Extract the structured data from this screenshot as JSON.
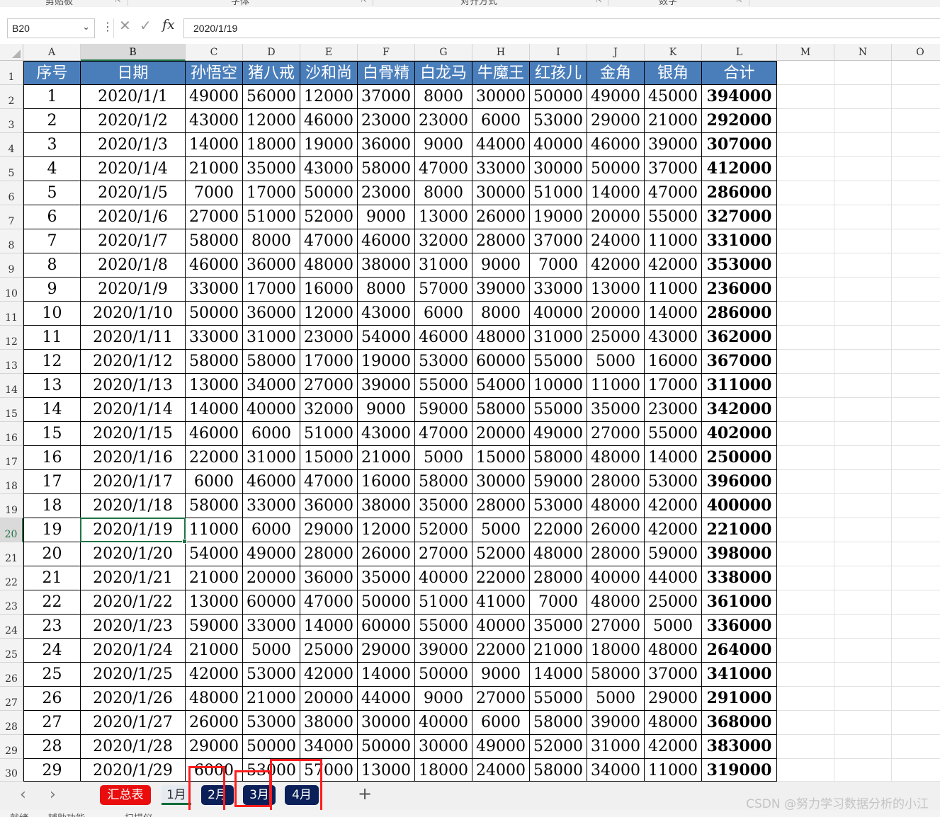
{
  "ribbon": {
    "groups": [
      "剪贴板",
      "字体",
      "对齐方式",
      "数字"
    ]
  },
  "formula_bar": {
    "name_box": "B20",
    "fx": "fx",
    "value": "2020/1/19"
  },
  "sheet": {
    "columns": [
      "A",
      "B",
      "C",
      "D",
      "E",
      "F",
      "G",
      "H",
      "I",
      "J",
      "K",
      "L",
      "M",
      "N",
      "O"
    ],
    "selected_column": "B",
    "selected_row": 20,
    "header_row": [
      "序号",
      "日期",
      "孙悟空",
      "猪八戒",
      "沙和尚",
      "白骨精",
      "白龙马",
      "牛魔王",
      "红孩儿",
      "金角",
      "银角",
      "合计"
    ],
    "rows": [
      [
        "1",
        "2020/1/1",
        "49000",
        "56000",
        "12000",
        "37000",
        "8000",
        "30000",
        "50000",
        "49000",
        "45000",
        "394000"
      ],
      [
        "2",
        "2020/1/2",
        "43000",
        "12000",
        "46000",
        "23000",
        "23000",
        "6000",
        "53000",
        "29000",
        "21000",
        "292000"
      ],
      [
        "3",
        "2020/1/3",
        "14000",
        "18000",
        "19000",
        "36000",
        "9000",
        "44000",
        "40000",
        "46000",
        "39000",
        "307000"
      ],
      [
        "4",
        "2020/1/4",
        "21000",
        "35000",
        "43000",
        "58000",
        "47000",
        "33000",
        "30000",
        "50000",
        "37000",
        "412000"
      ],
      [
        "5",
        "2020/1/5",
        "7000",
        "17000",
        "50000",
        "23000",
        "8000",
        "30000",
        "51000",
        "14000",
        "47000",
        "286000"
      ],
      [
        "6",
        "2020/1/6",
        "27000",
        "51000",
        "52000",
        "9000",
        "13000",
        "26000",
        "19000",
        "20000",
        "55000",
        "327000"
      ],
      [
        "7",
        "2020/1/7",
        "58000",
        "8000",
        "47000",
        "46000",
        "32000",
        "28000",
        "37000",
        "24000",
        "11000",
        "331000"
      ],
      [
        "8",
        "2020/1/8",
        "46000",
        "36000",
        "48000",
        "38000",
        "31000",
        "9000",
        "7000",
        "42000",
        "42000",
        "353000"
      ],
      [
        "9",
        "2020/1/9",
        "33000",
        "17000",
        "16000",
        "8000",
        "57000",
        "39000",
        "33000",
        "13000",
        "11000",
        "236000"
      ],
      [
        "10",
        "2020/1/10",
        "50000",
        "36000",
        "12000",
        "43000",
        "6000",
        "8000",
        "40000",
        "20000",
        "14000",
        "286000"
      ],
      [
        "11",
        "2020/1/11",
        "33000",
        "31000",
        "23000",
        "54000",
        "46000",
        "48000",
        "31000",
        "25000",
        "43000",
        "362000"
      ],
      [
        "12",
        "2020/1/12",
        "58000",
        "58000",
        "17000",
        "19000",
        "53000",
        "60000",
        "55000",
        "5000",
        "16000",
        "367000"
      ],
      [
        "13",
        "2020/1/13",
        "13000",
        "34000",
        "27000",
        "39000",
        "55000",
        "54000",
        "10000",
        "11000",
        "17000",
        "311000"
      ],
      [
        "14",
        "2020/1/14",
        "14000",
        "40000",
        "32000",
        "9000",
        "59000",
        "58000",
        "55000",
        "35000",
        "23000",
        "342000"
      ],
      [
        "15",
        "2020/1/15",
        "46000",
        "6000",
        "51000",
        "43000",
        "47000",
        "20000",
        "49000",
        "27000",
        "55000",
        "402000"
      ],
      [
        "16",
        "2020/1/16",
        "22000",
        "31000",
        "15000",
        "21000",
        "5000",
        "15000",
        "58000",
        "48000",
        "14000",
        "250000"
      ],
      [
        "17",
        "2020/1/17",
        "6000",
        "46000",
        "47000",
        "16000",
        "58000",
        "30000",
        "59000",
        "28000",
        "53000",
        "396000"
      ],
      [
        "18",
        "2020/1/18",
        "58000",
        "33000",
        "36000",
        "38000",
        "35000",
        "28000",
        "53000",
        "48000",
        "42000",
        "400000"
      ],
      [
        "19",
        "2020/1/19",
        "11000",
        "6000",
        "29000",
        "12000",
        "52000",
        "5000",
        "22000",
        "26000",
        "42000",
        "221000"
      ],
      [
        "20",
        "2020/1/20",
        "54000",
        "49000",
        "28000",
        "26000",
        "27000",
        "52000",
        "48000",
        "28000",
        "59000",
        "398000"
      ],
      [
        "21",
        "2020/1/21",
        "21000",
        "20000",
        "36000",
        "35000",
        "40000",
        "22000",
        "28000",
        "40000",
        "44000",
        "338000"
      ],
      [
        "22",
        "2020/1/22",
        "13000",
        "60000",
        "47000",
        "50000",
        "51000",
        "41000",
        "7000",
        "48000",
        "25000",
        "361000"
      ],
      [
        "23",
        "2020/1/23",
        "59000",
        "33000",
        "14000",
        "60000",
        "55000",
        "40000",
        "35000",
        "27000",
        "5000",
        "336000"
      ],
      [
        "24",
        "2020/1/24",
        "21000",
        "5000",
        "25000",
        "29000",
        "39000",
        "22000",
        "21000",
        "18000",
        "48000",
        "264000"
      ],
      [
        "25",
        "2020/1/25",
        "42000",
        "53000",
        "42000",
        "14000",
        "50000",
        "9000",
        "14000",
        "58000",
        "37000",
        "341000"
      ],
      [
        "26",
        "2020/1/26",
        "48000",
        "21000",
        "20000",
        "44000",
        "9000",
        "27000",
        "55000",
        "5000",
        "29000",
        "291000"
      ],
      [
        "27",
        "2020/1/27",
        "26000",
        "53000",
        "38000",
        "30000",
        "40000",
        "6000",
        "58000",
        "39000",
        "48000",
        "368000"
      ],
      [
        "28",
        "2020/1/28",
        "29000",
        "50000",
        "34000",
        "50000",
        "30000",
        "49000",
        "52000",
        "31000",
        "42000",
        "383000"
      ],
      [
        "29",
        "2020/1/29",
        "6000",
        "53000",
        "57000",
        "13000",
        "18000",
        "24000",
        "58000",
        "34000",
        "11000",
        "319000"
      ]
    ]
  },
  "tabs": {
    "items": [
      {
        "label": "汇总表",
        "style": "red"
      },
      {
        "label": "1月",
        "style": "active"
      },
      {
        "label": "2月",
        "style": "navy"
      },
      {
        "label": "3月",
        "style": "navy"
      },
      {
        "label": "4月",
        "style": "navy"
      }
    ],
    "add_label": "+",
    "prev_icon": "chevron-left-icon",
    "next_icon": "chevron-right-icon"
  },
  "status_bar": {
    "ready": "就绪",
    "accessibility": "辅助功能",
    "mode": "扫描仪"
  },
  "watermark": "CSDN @努力学习数据分析的小江",
  "colors": {
    "header_fill": "#4a7ebb",
    "tab_red": "#e90d0d",
    "tab_navy": "#0b1f58",
    "highlight": "#ff1c1c",
    "selection": "#217346"
  }
}
